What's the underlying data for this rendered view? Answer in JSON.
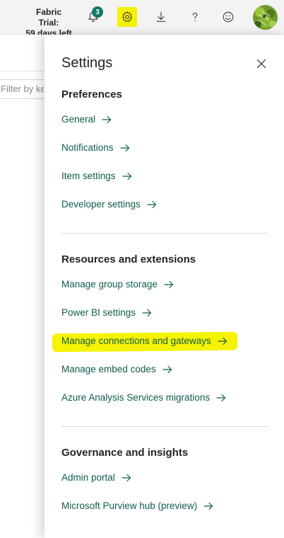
{
  "header": {
    "trial_line1": "Fabric Trial:",
    "trial_line2": "59 days left",
    "notification_count": "3",
    "icons": [
      "bell-icon",
      "gear-icon",
      "download-icon",
      "help-icon",
      "smiley-icon"
    ],
    "accent": "#117865",
    "highlight_color": "#f5f200"
  },
  "left": {
    "filter_placeholder": "Filter by ke"
  },
  "settings": {
    "title": "Settings",
    "sections": [
      {
        "title": "Preferences",
        "links": [
          "General",
          "Notifications",
          "Item settings",
          "Developer settings"
        ]
      },
      {
        "title": "Resources and extensions",
        "links": [
          "Manage group storage",
          "Power BI settings",
          "Manage connections and gateways",
          "Manage embed codes",
          "Azure Analysis Services migrations"
        ]
      },
      {
        "title": "Governance and insights",
        "links": [
          "Admin portal",
          "Microsoft Purview hub (preview)"
        ]
      }
    ],
    "link_color": "#0e5d4f",
    "highlighted_link": "Manage connections and gateways"
  }
}
